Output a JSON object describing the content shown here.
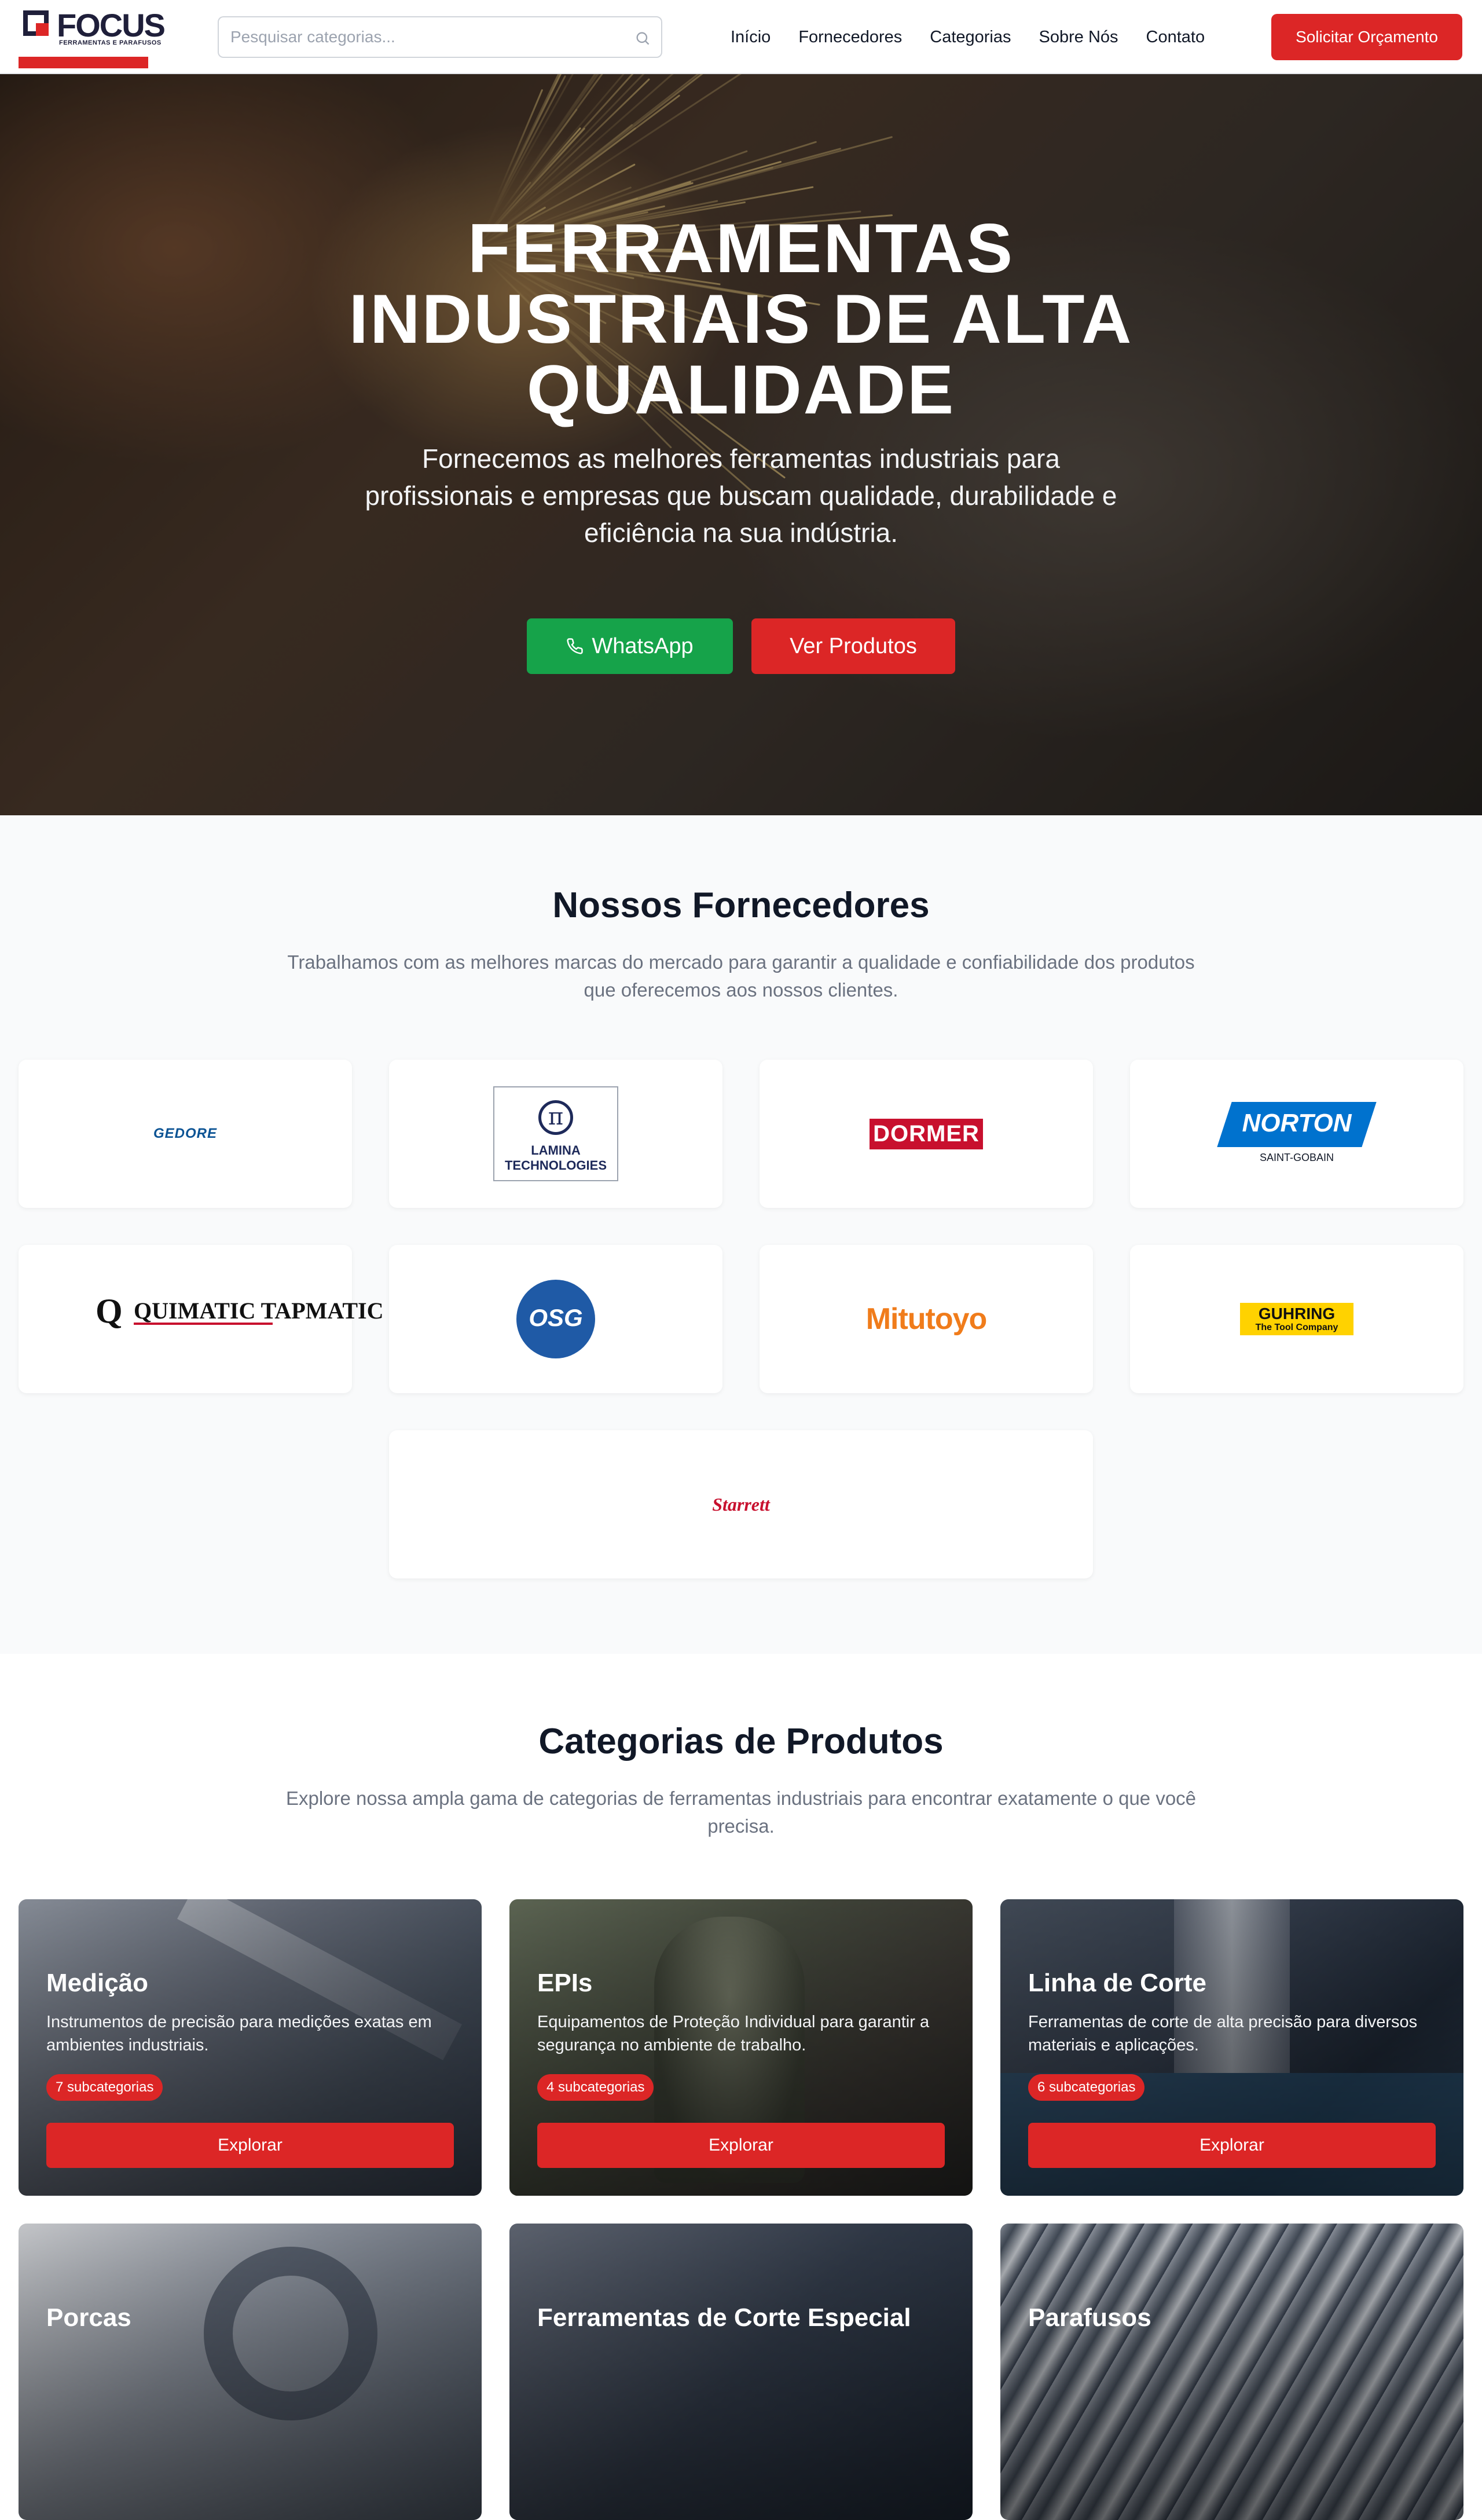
{
  "header": {
    "logo_text": "FOCUS",
    "logo_sub": "FERRAMENTAS E PARAFUSOS",
    "search_placeholder": "Pesquisar categorias...",
    "nav": [
      "Início",
      "Fornecedores",
      "Categorias",
      "Sobre Nós",
      "Contato"
    ],
    "cta_label": "Solicitar Orçamento"
  },
  "hero": {
    "title": "FERRAMENTAS INDUSTRIAIS DE ALTA QUALIDADE",
    "subtitle": "Fornecemos as melhores ferramentas industriais para profissionais e empresas que buscam qualidade, durabilidade e eficiência na sua indústria.",
    "whatsapp_label": "WhatsApp",
    "products_label": "Ver Produtos"
  },
  "suppliers": {
    "title": "Nossos Fornecedores",
    "description": "Trabalhamos com as melhores marcas do mercado para garantir a qualidade e confiabilidade dos produtos que oferecemos aos nossos clientes.",
    "brands": [
      "GEDORE",
      "LAMINA TECHNOLOGIES",
      "DORMER",
      "NORTON",
      "QUIMATIC TAPMATIC",
      "OSG",
      "Mitutoyo",
      "GUHRING",
      "Starrett"
    ],
    "norton_sub": "SAINT-GOBAIN",
    "guhring_sub": "The Tool Company"
  },
  "categories": {
    "title": "Categorias de Produtos",
    "description": "Explore nossa ampla gama de categorias de ferramentas industriais para encontrar exatamente o que você precisa.",
    "items": [
      {
        "name": "Medição",
        "description": "Instrumentos de precisão para medições exatas em ambientes industriais.",
        "badge": "7 subcategorias",
        "button": "Explorar"
      },
      {
        "name": "EPIs",
        "description": "Equipamentos de Proteção Individual para garantir a segurança no ambiente de trabalho.",
        "badge": "4 subcategorias",
        "button": "Explorar"
      },
      {
        "name": "Linha de Corte",
        "description": "Ferramentas de corte de alta precisão para diversos materiais e aplicações.",
        "badge": "6 subcategorias",
        "button": "Explorar"
      },
      {
        "name": "Porcas"
      },
      {
        "name": "Ferramentas de Corte Especial"
      },
      {
        "name": "Parafusos"
      }
    ]
  },
  "colors": {
    "brand_red": "#dc2626",
    "whatsapp_green": "#16a34a",
    "navy": "#1f1f3a"
  }
}
